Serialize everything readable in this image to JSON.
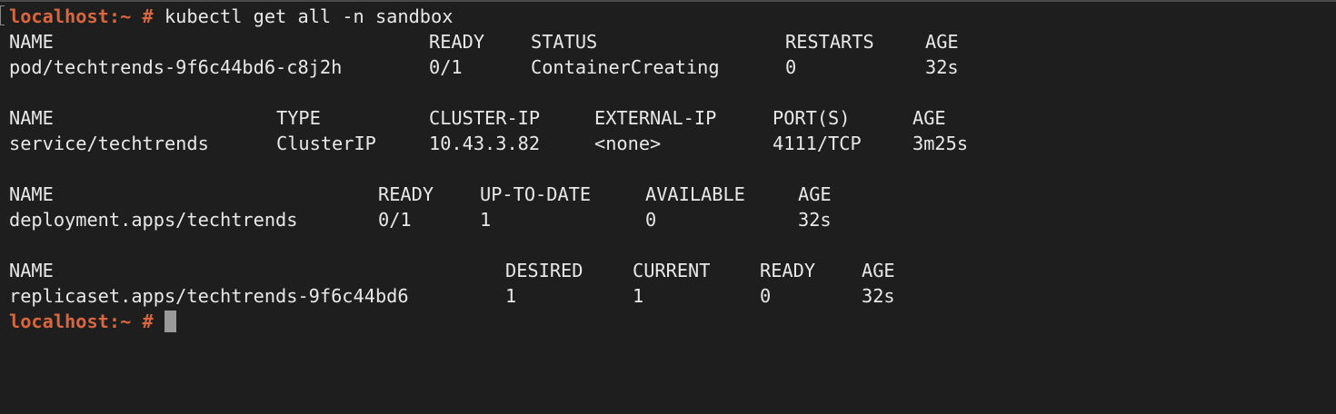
{
  "prompt": "localhost:~ # ",
  "command": "kubectl get all -n sandbox",
  "pods": {
    "headers": [
      "NAME",
      "READY",
      "STATUS",
      "RESTARTS",
      "AGE"
    ],
    "rows": [
      [
        "pod/techtrends-9f6c44bd6-c8j2h",
        "0/1",
        "ContainerCreating",
        "0",
        "32s"
      ]
    ]
  },
  "services": {
    "headers": [
      "NAME",
      "TYPE",
      "CLUSTER-IP",
      "EXTERNAL-IP",
      "PORT(S)",
      "AGE"
    ],
    "rows": [
      [
        "service/techtrends",
        "ClusterIP",
        "10.43.3.82",
        "<none>",
        "4111/TCP",
        "3m25s"
      ]
    ]
  },
  "deployments": {
    "headers": [
      "NAME",
      "READY",
      "UP-TO-DATE",
      "AVAILABLE",
      "AGE"
    ],
    "rows": [
      [
        "deployment.apps/techtrends",
        "0/1",
        "1",
        "0",
        "32s"
      ]
    ]
  },
  "replicasets": {
    "headers": [
      "NAME",
      "DESIRED",
      "CURRENT",
      "READY",
      "AGE"
    ],
    "rows": [
      [
        "replicaset.apps/techtrends-9f6c44bd6",
        "1",
        "1",
        "0",
        "32s"
      ]
    ]
  },
  "colors": {
    "background": "#1e1e1e",
    "text": "#e8e8e8",
    "prompt": "#d8663f",
    "cursor": "#9a9a9a"
  }
}
